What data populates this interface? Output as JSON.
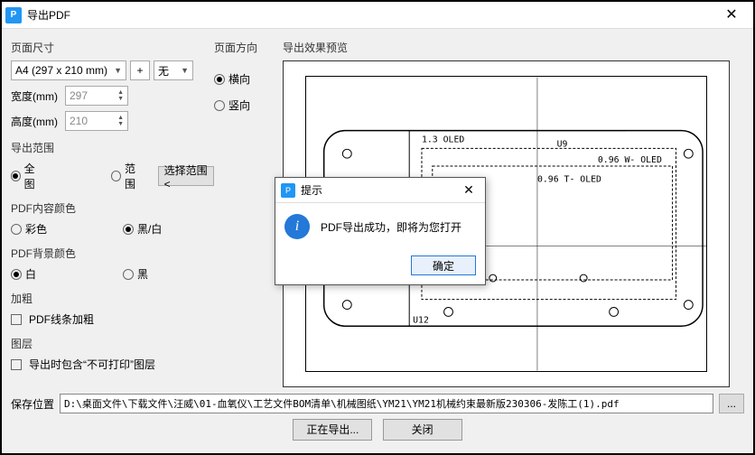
{
  "window": {
    "title": "导出PDF"
  },
  "page_size": {
    "title": "页面尺寸",
    "preset": "A4 (297 x 210 mm)",
    "unit": "无",
    "width_label": "宽度(mm)",
    "width": "297",
    "height_label": "高度(mm)",
    "height": "210"
  },
  "orientation": {
    "title": "页面方向",
    "landscape": "横向",
    "portrait": "竖向",
    "selected": "landscape"
  },
  "preview": {
    "title": "导出效果预览"
  },
  "export_range": {
    "title": "导出范围",
    "all": "全图",
    "range": "范围",
    "select_btn": "选择范围<",
    "selected": "all"
  },
  "content_color": {
    "title": "PDF内容颜色",
    "color": "彩色",
    "bw": "黑/白",
    "selected": "bw"
  },
  "bg_color": {
    "title": "PDF背景颜色",
    "white": "白",
    "black": "黑",
    "selected": "white"
  },
  "bold": {
    "title": "加粗",
    "checkbox": "PDF线条加粗"
  },
  "layer": {
    "title": "图层",
    "checkbox": "导出时包含“不可打印”图层"
  },
  "save": {
    "label": "保存位置",
    "path": "D:\\桌面文件\\下载文件\\汪威\\01-血氧仪\\工艺文件BOM清单\\机械图纸\\YM21\\YM21机械约束最新版230306-发陈工(1).pdf",
    "browse": "..."
  },
  "buttons": {
    "exporting": "正在导出...",
    "close": "关闭"
  },
  "dialog": {
    "title": "提示",
    "message": "PDF导出成功，即将为您打开",
    "ok": "确定"
  },
  "drawing": {
    "l1": "1.3 OLED",
    "u9": "U9",
    "l2": "0.96  W- OLED",
    "l3": "0.96   T- OLED",
    "u12": "U12"
  }
}
